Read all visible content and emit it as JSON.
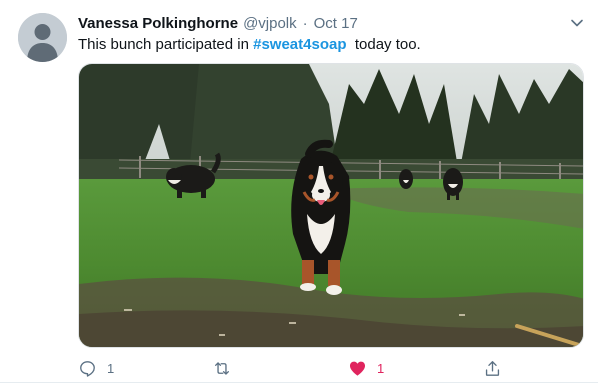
{
  "tweet": {
    "author_name": "Vanessa Polkinghorne",
    "handle": "@vjpolk",
    "separator": "·",
    "date": "Oct 17",
    "text_before": "This bunch participated in",
    "hashtag": "#sweat4soap",
    "text_after": "today too.",
    "media_alt": ""
  },
  "actions": {
    "reply_count": "1",
    "retweet_count": "",
    "like_count": "1",
    "liked": true
  },
  "colors": {
    "hashtag": "#1b95e0",
    "like": "#e0245e",
    "secondary_text": "#5b7083"
  },
  "icons": [
    "avatar-placeholder-icon",
    "chevron-down-icon",
    "reply-icon",
    "retweet-icon",
    "heart-icon",
    "share-icon"
  ]
}
